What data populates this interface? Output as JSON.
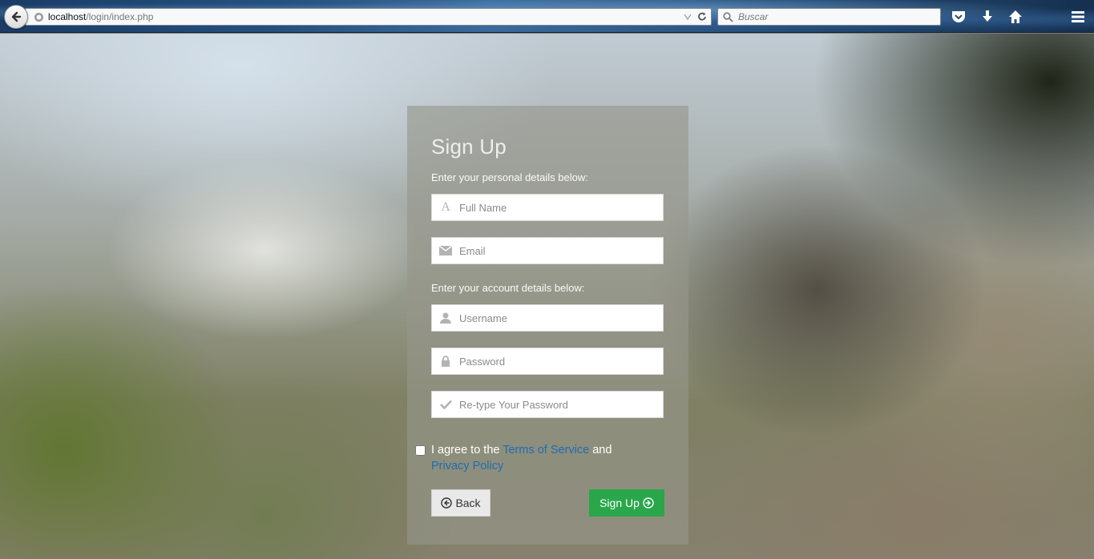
{
  "browser": {
    "url_host": "localhost",
    "url_path": "/login/index.php",
    "search_placeholder": "Buscar"
  },
  "form": {
    "title": "Sign Up",
    "personal_label": "Enter your personal details below:",
    "account_label": "Enter your account details below:",
    "fields": {
      "full_name": "Full Name",
      "email": "Email",
      "username": "Username",
      "password": "Password",
      "retype_password": "Re-type Your Password"
    },
    "agree": {
      "prefix": "I agree to the ",
      "terms": "Terms of Service",
      "and": " and",
      "privacy": "Privacy Policy"
    },
    "back_label": "Back",
    "signup_label": "Sign Up"
  },
  "colors": {
    "signup_button": "#29a74a",
    "link": "#1d6db0"
  }
}
